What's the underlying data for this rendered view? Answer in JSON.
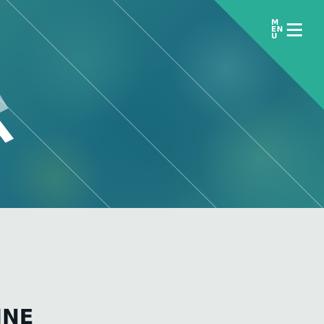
{
  "header": {
    "menu_label": "MENU",
    "menu_icon": "hamburger-icon"
  },
  "hero": {
    "logo_mark_icon": "x-logo-mark-icon"
  },
  "content": {
    "heading_fragment": "INE"
  },
  "colors": {
    "corner_accent": "#2aae98",
    "hero_teal": "#1d6c80",
    "content_background": "#e5eae8",
    "heading_text": "#101820",
    "menu_text": "#ffffff"
  }
}
